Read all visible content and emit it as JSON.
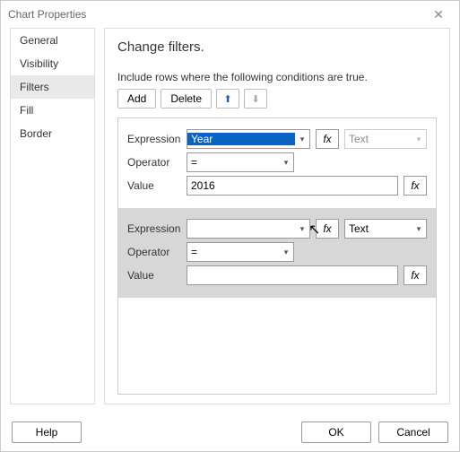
{
  "window": {
    "title": "Chart Properties",
    "close_glyph": "✕"
  },
  "sidebar": {
    "items": [
      {
        "label": "General"
      },
      {
        "label": "Visibility"
      },
      {
        "label": "Filters",
        "selected": true
      },
      {
        "label": "Fill"
      },
      {
        "label": "Border"
      }
    ]
  },
  "main": {
    "heading": "Change filters.",
    "subtext": "Include rows where the following conditions are true.",
    "toolbar": {
      "add_label": "Add",
      "delete_label": "Delete",
      "move_up_glyph": "⬆",
      "move_down_glyph": "⬇"
    },
    "labels": {
      "expression": "Expression",
      "operator": "Operator",
      "value": "Value",
      "fx": "fx",
      "dropdown_glyph": "▾"
    },
    "filters": [
      {
        "expression": "Year",
        "operator": "=",
        "value": "2016",
        "type": "Text",
        "expression_selected": true,
        "active": false
      },
      {
        "expression": "",
        "operator": "=",
        "value": "",
        "type": "Text",
        "expression_selected": false,
        "active": true
      }
    ]
  },
  "footer": {
    "help_label": "Help",
    "ok_label": "OK",
    "cancel_label": "Cancel"
  },
  "cursor_glyph": "⤡"
}
